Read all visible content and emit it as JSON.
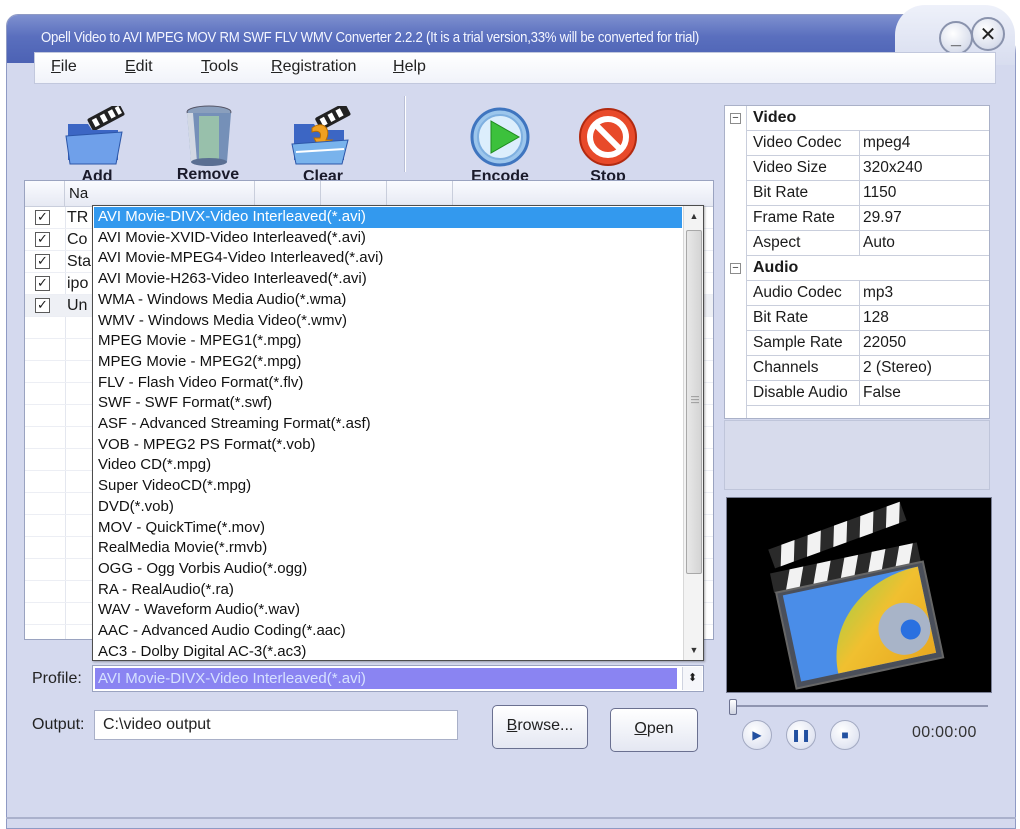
{
  "window": {
    "title": "Opell Video to AVI MPEG MOV RM SWF FLV WMV Converter 2.2.2 (It is a trial version,33% will be converted for trial)",
    "minimize_icon": "minimize-icon",
    "close_icon": "close-icon"
  },
  "menu": [
    {
      "label": "File",
      "accel": "F",
      "rest": "ile"
    },
    {
      "label": "Edit",
      "accel": "E",
      "rest": "dit"
    },
    {
      "label": "Tools",
      "accel": "T",
      "rest": "ools"
    },
    {
      "label": "Registration",
      "accel": "R",
      "rest": "egistration"
    },
    {
      "label": "Help",
      "accel": "H",
      "rest": "elp"
    }
  ],
  "toolbar": {
    "add": {
      "label": "Add",
      "icon": "folder-film-icon"
    },
    "remove": {
      "label": "Remove",
      "icon": "trash-can-icon"
    },
    "clear": {
      "label": "Clear",
      "icon": "folder-clear-icon"
    },
    "encode": {
      "label": "Encode",
      "icon": "play-circle-icon"
    },
    "stop": {
      "label": "Stop",
      "icon": "stop-sign-icon"
    }
  },
  "file_list": {
    "header_name": "Na",
    "rows": [
      {
        "checked": true,
        "name": "TR"
      },
      {
        "checked": true,
        "name": "Co"
      },
      {
        "checked": true,
        "name": "Sta"
      },
      {
        "checked": true,
        "name": "ipo"
      },
      {
        "checked": true,
        "name": "Un"
      }
    ]
  },
  "profile_dropdown": {
    "selected_index": 0,
    "options": [
      "AVI Movie-DIVX-Video Interleaved(*.avi)",
      "AVI Movie-XVID-Video Interleaved(*.avi)",
      "AVI Movie-MPEG4-Video Interleaved(*.avi)",
      "AVI Movie-H263-Video Interleaved(*.avi)",
      "WMA - Windows Media Audio(*.wma)",
      "WMV - Windows Media Video(*.wmv)",
      "MPEG Movie - MPEG1(*.mpg)",
      "MPEG Movie - MPEG2(*.mpg)",
      "FLV - Flash Video Format(*.flv)",
      "SWF - SWF Format(*.swf)",
      "ASF - Advanced Streaming Format(*.asf)",
      "VOB - MPEG2 PS Format(*.vob)",
      "Video CD(*.mpg)",
      "Super VideoCD(*.mpg)",
      "DVD(*.vob)",
      "MOV - QuickTime(*.mov)",
      "RealMedia Movie(*.rmvb)",
      "OGG - Ogg Vorbis Audio(*.ogg)",
      "RA - RealAudio(*.ra)",
      "WAV - Waveform Audio(*.wav)",
      "AAC - Advanced Audio Coding(*.aac)",
      "AC3 - Dolby Digital AC-3(*.ac3)"
    ]
  },
  "profile": {
    "label": "Profile:",
    "value": "AVI Movie-DIVX-Video Interleaved(*.avi)"
  },
  "output": {
    "label": "Output:",
    "value": "C:\\video output",
    "browse": {
      "accel": "B",
      "rest": "rowse..."
    },
    "open": {
      "accel": "O",
      "rest": "pen"
    }
  },
  "properties": {
    "video": {
      "title": "Video",
      "items": [
        {
          "key": "Video Codec",
          "value": "mpeg4"
        },
        {
          "key": "Video Size",
          "value": "320x240"
        },
        {
          "key": "Bit Rate",
          "value": "1150"
        },
        {
          "key": "Frame Rate",
          "value": "29.97"
        },
        {
          "key": "Aspect",
          "value": "Auto"
        }
      ]
    },
    "audio": {
      "title": "Audio",
      "items": [
        {
          "key": "Audio Codec",
          "value": "mp3"
        },
        {
          "key": "Bit Rate",
          "value": "128"
        },
        {
          "key": "Sample Rate",
          "value": "22050"
        },
        {
          "key": "Channels",
          "value": "2 (Stereo)"
        },
        {
          "key": "Disable Audio",
          "value": "False"
        }
      ]
    }
  },
  "player": {
    "time": "00:00:00",
    "position": 0,
    "preview_icon": "clapperboard-disc-icon"
  }
}
